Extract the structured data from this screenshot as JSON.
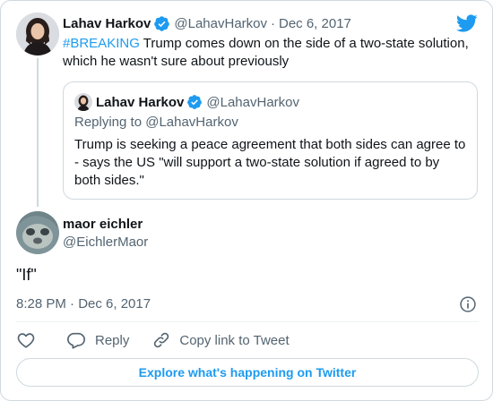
{
  "colors": {
    "accent": "#1d9bf0",
    "text": "#0f1419",
    "muted": "#536471",
    "border": "#cfd9de"
  },
  "parent_tweet": {
    "author_name": "Lahav Harkov",
    "handle": "@LahavHarkov",
    "separator": "·",
    "date": "Dec 6, 2017",
    "hashtag": "#BREAKING",
    "text": " Trump comes down on the side of a two-state solution, which he wasn't sure about previously",
    "verified_icon": "verified-badge-icon",
    "avatar_icon": "profile-photo"
  },
  "quoted_tweet": {
    "author_name": "Lahav Harkov",
    "handle": "@LahavHarkov",
    "replying_to": "Replying to @LahavHarkov",
    "text": "Trump is seeking a peace agreement that both sides can agree to - says the US \"will support a two-state solution if agreed to by both sides.\""
  },
  "main_tweet": {
    "author_name": "maor eichler",
    "handle": "@EichlerMaor",
    "text": "\"If\"",
    "timestamp": "8:28 PM · Dec 6, 2017",
    "avatar_icon": "profile-photo"
  },
  "actions": {
    "reply_label": "Reply",
    "copy_link_label": "Copy link to Tweet",
    "explore_label": "Explore what's happening on Twitter"
  },
  "icons": {
    "brand": "twitter-bird-icon",
    "like": "heart-icon",
    "reply": "speech-bubble-icon",
    "copy": "link-icon",
    "info": "info-icon"
  }
}
